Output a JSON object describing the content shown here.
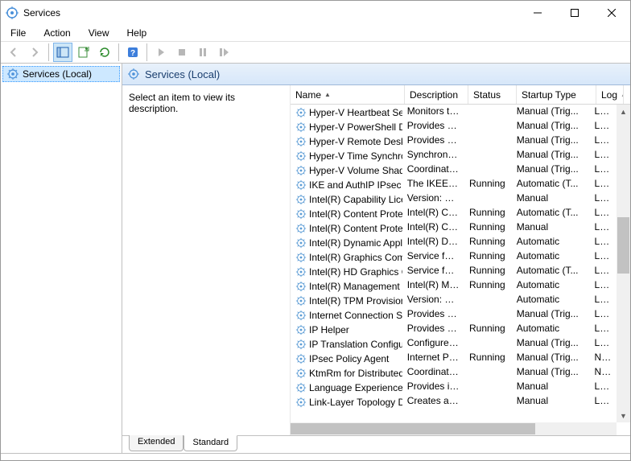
{
  "title": "Services",
  "menu": {
    "file": "File",
    "action": "Action",
    "view": "View",
    "help": "Help"
  },
  "tree": {
    "root": "Services (Local)"
  },
  "header": {
    "label": "Services (Local)"
  },
  "desc_pane": {
    "prompt": "Select an item to view its description."
  },
  "columns": {
    "name": "Name",
    "description": "Description",
    "status": "Status",
    "startup": "Startup Type",
    "logon": "Log"
  },
  "tabs": {
    "extended": "Extended",
    "standard": "Standard"
  },
  "services": [
    {
      "name": "Hyper-V Heartbeat Service",
      "desc": "Monitors th...",
      "status": "",
      "startup": "Manual (Trig...",
      "logon": "Loca"
    },
    {
      "name": "Hyper-V PowerShell Direct ...",
      "desc": "Provides a ...",
      "status": "",
      "startup": "Manual (Trig...",
      "logon": "Loca"
    },
    {
      "name": "Hyper-V Remote Desktop Vi...",
      "desc": "Provides a p...",
      "status": "",
      "startup": "Manual (Trig...",
      "logon": "Loca"
    },
    {
      "name": "Hyper-V Time Synchronizati...",
      "desc": "Synchronize...",
      "status": "",
      "startup": "Manual (Trig...",
      "logon": "Loca"
    },
    {
      "name": "Hyper-V Volume Shadow C...",
      "desc": "Coordinates...",
      "status": "",
      "startup": "Manual (Trig...",
      "logon": "Loca"
    },
    {
      "name": "IKE and AuthIP IPsec Keying...",
      "desc": "The IKEEXT ...",
      "status": "Running",
      "startup": "Automatic (T...",
      "logon": "Loca"
    },
    {
      "name": "Intel(R) Capability Licensing...",
      "desc": "Version: 1.6...",
      "status": "",
      "startup": "Manual",
      "logon": "Loca"
    },
    {
      "name": "Intel(R) Content Protection ...",
      "desc": "Intel(R) Con...",
      "status": "Running",
      "startup": "Automatic (T...",
      "logon": "Loca"
    },
    {
      "name": "Intel(R) Content Protection ...",
      "desc": "Intel(R) Con...",
      "status": "Running",
      "startup": "Manual",
      "logon": "Loca"
    },
    {
      "name": "Intel(R) Dynamic Applicatio...",
      "desc": "Intel(R) Dyn...",
      "status": "Running",
      "startup": "Automatic",
      "logon": "Loca"
    },
    {
      "name": "Intel(R) Graphics Command...",
      "desc": "Service for I...",
      "status": "Running",
      "startup": "Automatic",
      "logon": "Loca"
    },
    {
      "name": "Intel(R) HD Graphics Contro...",
      "desc": "Service for I...",
      "status": "Running",
      "startup": "Automatic (T...",
      "logon": "Loca"
    },
    {
      "name": "Intel(R) Management and S...",
      "desc": "Intel(R) Ma...",
      "status": "Running",
      "startup": "Automatic",
      "logon": "Loca"
    },
    {
      "name": "Intel(R) TPM Provisioning S...",
      "desc": "Version: 1.6...",
      "status": "",
      "startup": "Automatic",
      "logon": "Loca"
    },
    {
      "name": "Internet Connection Sharin...",
      "desc": "Provides ne...",
      "status": "",
      "startup": "Manual (Trig...",
      "logon": "Loca"
    },
    {
      "name": "IP Helper",
      "desc": "Provides tu...",
      "status": "Running",
      "startup": "Automatic",
      "logon": "Loca"
    },
    {
      "name": "IP Translation Configuration...",
      "desc": "Configures ...",
      "status": "",
      "startup": "Manual (Trig...",
      "logon": "Loca"
    },
    {
      "name": "IPsec Policy Agent",
      "desc": "Internet Pro...",
      "status": "Running",
      "startup": "Manual (Trig...",
      "logon": "Netv"
    },
    {
      "name": "KtmRm for Distributed Tran...",
      "desc": "Coordinates...",
      "status": "",
      "startup": "Manual (Trig...",
      "logon": "Netv"
    },
    {
      "name": "Language Experience Service",
      "desc": "Provides inf...",
      "status": "",
      "startup": "Manual",
      "logon": "Loca"
    },
    {
      "name": "Link-Layer Topology Discov...",
      "desc": "Creates a N...",
      "status": "",
      "startup": "Manual",
      "logon": "Loca"
    }
  ]
}
